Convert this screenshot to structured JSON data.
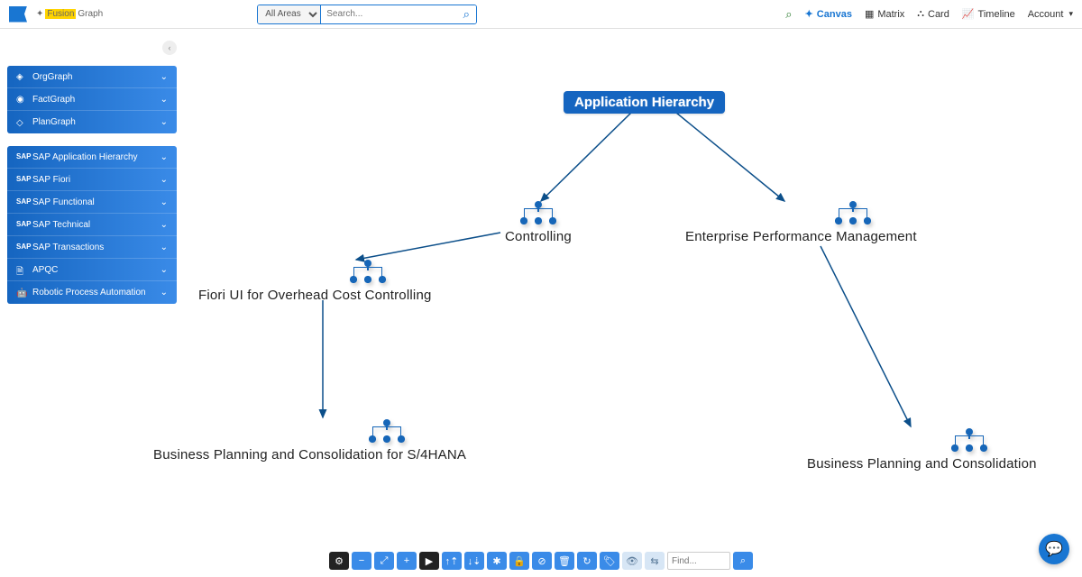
{
  "header": {
    "brand_hl": "Fusion",
    "brand_rest": "Graph",
    "search_select": "All Areas",
    "search_placeholder": "Search...",
    "nav": {
      "canvas": "Canvas",
      "matrix": "Matrix",
      "card": "Card",
      "timeline": "Timeline",
      "account": "Account"
    }
  },
  "sidebar": {
    "group1": [
      {
        "label": "OrgGraph"
      },
      {
        "label": "FactGraph"
      },
      {
        "label": "PlanGraph"
      }
    ],
    "group2": [
      {
        "label": "SAP Application Hierarchy",
        "icon": "sap"
      },
      {
        "label": "SAP Fiori",
        "icon": "sap"
      },
      {
        "label": "SAP Functional",
        "icon": "sap"
      },
      {
        "label": "SAP Technical",
        "icon": "sap"
      },
      {
        "label": "SAP Transactions",
        "icon": "sap"
      },
      {
        "label": "APQC",
        "icon": "doc"
      },
      {
        "label": "Robotic Process Automation",
        "icon": "bot"
      }
    ]
  },
  "canvas": {
    "nodes": {
      "root": "Application Hierarchy",
      "controlling": "Controlling",
      "epm": "Enterprise Performance Management",
      "fiori_overhead": "Fiori UI for Overhead Cost Controlling",
      "bpc_s4": "Business Planning and Consolidation for S/4HANA",
      "bpc": "Business Planning and Consolidation"
    }
  },
  "bottombar": {
    "find_placeholder": "Find..."
  }
}
